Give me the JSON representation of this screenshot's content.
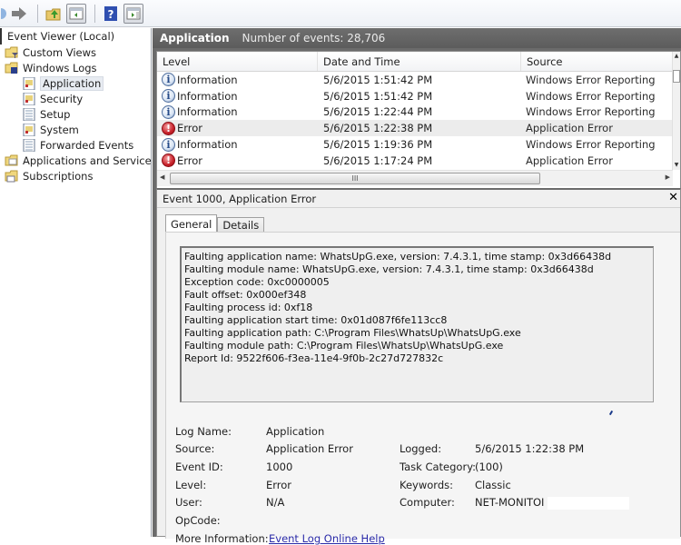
{
  "toolbar": {
    "buttons": [
      {
        "name": "back-button",
        "icon": "arrow-left-icon"
      },
      {
        "name": "forward-button",
        "icon": "arrow-right-icon"
      },
      {
        "name": "up-folder-button",
        "icon": "folder-up-icon"
      },
      {
        "name": "show-hide-tree-button",
        "icon": "console-tree-icon"
      },
      {
        "name": "help-button",
        "icon": "help-icon"
      },
      {
        "name": "show-hide-action-pane-button",
        "icon": "action-pane-icon"
      }
    ]
  },
  "tree": {
    "root": "Event Viewer (Local)",
    "items": [
      {
        "label": "Custom Views",
        "level": 1,
        "icon": "folder-filter-icon"
      },
      {
        "label": "Windows Logs",
        "level": 1,
        "icon": "folder-logs-icon"
      },
      {
        "label": "Application",
        "level": 2,
        "icon": "log-icon",
        "selected": true
      },
      {
        "label": "Security",
        "level": 2,
        "icon": "log-icon"
      },
      {
        "label": "Setup",
        "level": 2,
        "icon": "log-plain-icon"
      },
      {
        "label": "System",
        "level": 2,
        "icon": "log-icon"
      },
      {
        "label": "Forwarded Events",
        "level": 2,
        "icon": "log-plain-icon"
      },
      {
        "label": "Applications and Services Lo",
        "level": 1,
        "icon": "folder-icon"
      },
      {
        "label": "Subscriptions",
        "level": 1,
        "icon": "folder-subscriptions-icon"
      }
    ]
  },
  "header": {
    "title": "Application",
    "count_label": "Number of events: 28,706"
  },
  "events": {
    "columns": [
      "Level",
      "Date and Time",
      "Source"
    ],
    "rows": [
      {
        "level": "Information",
        "type": "info",
        "date": "5/6/2015 1:51:42 PM",
        "source": "Windows Error Reporting"
      },
      {
        "level": "Information",
        "type": "info",
        "date": "5/6/2015 1:51:42 PM",
        "source": "Windows Error Reporting"
      },
      {
        "level": "Information",
        "type": "info",
        "date": "5/6/2015 1:22:44 PM",
        "source": "Windows Error Reporting"
      },
      {
        "level": "Error",
        "type": "error",
        "date": "5/6/2015 1:22:38 PM",
        "source": "Application Error",
        "selected": true
      },
      {
        "level": "Information",
        "type": "info",
        "date": "5/6/2015 1:19:36 PM",
        "source": "Windows Error Reporting"
      },
      {
        "level": "Error",
        "type": "error",
        "date": "5/6/2015 1:17:24 PM",
        "source": "Application Error"
      }
    ],
    "hscroll_grip": "III"
  },
  "detail": {
    "title": "Event 1000, Application Error",
    "close_glyph": "✕",
    "tabs": [
      {
        "label": "General",
        "active": true
      },
      {
        "label": "Details",
        "active": false
      }
    ],
    "description_lines": [
      "Faulting application name: WhatsUpG.exe, version: 7.4.3.1, time stamp: 0x3d66438d",
      "Faulting module name: WhatsUpG.exe, version: 7.4.3.1, time stamp: 0x3d66438d",
      "Exception code: 0xc0000005",
      "Fault offset: 0x000ef348",
      "Faulting process id: 0xf18",
      "Faulting application start time: 0x01d087f6fe113cc8",
      "Faulting application path: C:\\Program Files\\WhatsUp\\WhatsUpG.exe",
      "Faulting module path: C:\\Program Files\\WhatsUp\\WhatsUpG.exe",
      "Report Id: 9522f606-f3ea-11e4-9f0b-2c27d727832c"
    ],
    "properties": {
      "log_name": {
        "label": "Log Name:",
        "value": "Application"
      },
      "source": {
        "label": "Source:",
        "value": "Application Error"
      },
      "event_id": {
        "label": "Event ID:",
        "value": "1000"
      },
      "level": {
        "label": "Level:",
        "value": "Error"
      },
      "user": {
        "label": "User:",
        "value": "N/A"
      },
      "opcode": {
        "label": "OpCode:",
        "value": ""
      },
      "more_info": {
        "label": "More Information:",
        "value": "Event Log Online Help"
      },
      "logged": {
        "label": "Logged:",
        "value": "5/6/2015 1:22:38 PM"
      },
      "task_category": {
        "label": "Task Category:",
        "value": "(100)"
      },
      "keywords": {
        "label": "Keywords:",
        "value": "Classic"
      },
      "computer": {
        "label": "Computer:",
        "value": "NET-MONITOI"
      }
    }
  },
  "colors": {
    "header_bar": "#5f5f5f",
    "link": "#2a2aa8",
    "error_red": "#c8212a",
    "info_blue": "#4f6e9e"
  }
}
